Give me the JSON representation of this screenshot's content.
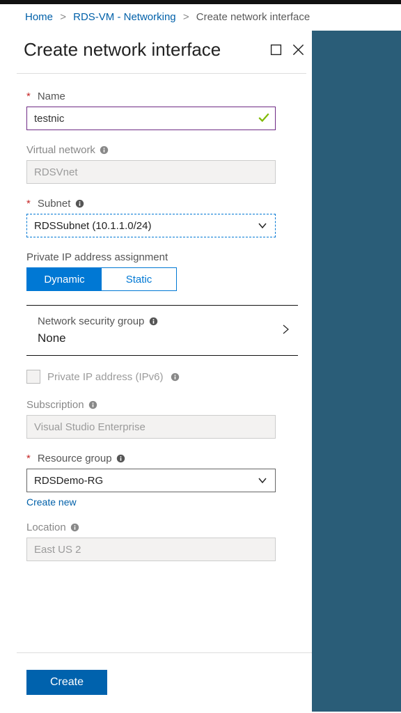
{
  "breadcrumb": {
    "home": "Home",
    "parent": "RDS-VM - Networking",
    "current": "Create network interface"
  },
  "panel": {
    "title": "Create network interface"
  },
  "fields": {
    "name": {
      "label": "Name",
      "value": "testnic"
    },
    "vnet": {
      "label": "Virtual network",
      "value": "RDSVnet"
    },
    "subnet": {
      "label": "Subnet",
      "value": "RDSSubnet (10.1.1.0/24)"
    },
    "ip_assignment": {
      "label": "Private IP address assignment",
      "dynamic": "Dynamic",
      "static": "Static"
    },
    "nsg": {
      "label": "Network security group",
      "value": "None"
    },
    "ipv6": {
      "label": "Private IP address (IPv6)"
    },
    "subscription": {
      "label": "Subscription",
      "value": "Visual Studio Enterprise"
    },
    "rg": {
      "label": "Resource group",
      "value": "RDSDemo-RG",
      "create_new": "Create new"
    },
    "location": {
      "label": "Location",
      "value": "East US 2"
    }
  },
  "buttons": {
    "create": "Create"
  }
}
